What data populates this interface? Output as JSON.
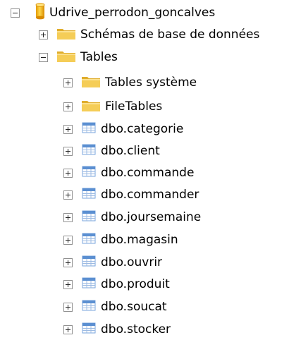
{
  "tree": {
    "database": {
      "label": "Udrive_perrodon_goncalves",
      "expanded": true,
      "icon": "database-cylinder-icon",
      "color": "#f5b800"
    },
    "schemas_folder": {
      "label": "Schémas de base de données",
      "expanded": false,
      "icon": "folder-icon"
    },
    "tables_folder": {
      "label": "Tables",
      "expanded": true,
      "icon": "folder-icon"
    },
    "children": [
      {
        "label": "Tables système",
        "type": "folder",
        "expanded": false,
        "icon": "folder-icon"
      },
      {
        "label": "FileTables",
        "type": "folder",
        "expanded": false,
        "icon": "folder-icon"
      },
      {
        "label": "dbo.categorie",
        "type": "table",
        "expanded": false,
        "icon": "table-icon"
      },
      {
        "label": "dbo.client",
        "type": "table",
        "expanded": false,
        "icon": "table-icon"
      },
      {
        "label": "dbo.commande",
        "type": "table",
        "expanded": false,
        "icon": "table-icon"
      },
      {
        "label": "dbo.commander",
        "type": "table",
        "expanded": false,
        "icon": "table-icon"
      },
      {
        "label": "dbo.joursemaine",
        "type": "table",
        "expanded": false,
        "icon": "table-icon"
      },
      {
        "label": "dbo.magasin",
        "type": "table",
        "expanded": false,
        "icon": "table-icon"
      },
      {
        "label": "dbo.ouvrir",
        "type": "table",
        "expanded": false,
        "icon": "table-icon"
      },
      {
        "label": "dbo.produit",
        "type": "table",
        "expanded": false,
        "icon": "table-icon"
      },
      {
        "label": "dbo.soucat",
        "type": "table",
        "expanded": false,
        "icon": "table-icon"
      },
      {
        "label": "dbo.stocker",
        "type": "table",
        "expanded": false,
        "icon": "table-icon"
      }
    ]
  },
  "colors": {
    "folder_fill": "#f2c94c",
    "folder_tab": "#e0ad2c",
    "table_header": "#5b8fd1",
    "table_grid": "#9dbbe3",
    "expander_border": "#919191"
  }
}
